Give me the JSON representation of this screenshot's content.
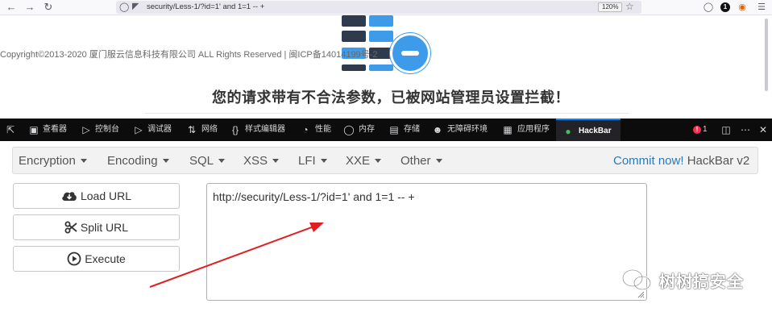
{
  "browser": {
    "url": "security/Less-1/?id=1' and 1=1 -- +",
    "zoom": "120%",
    "profile_badge": "1"
  },
  "page": {
    "copyright": "Copyright©2013-2020 厦门服云信息科技有限公司 ALL Rights Reserved | 闽ICP备14014199号-2",
    "block_message": "您的请求带有不合法参数，已被网站管理员设置拦截！"
  },
  "devtools": {
    "tabs": [
      "查看器",
      "控制台",
      "调试器",
      "网络",
      "样式编辑器",
      "性能",
      "内存",
      "存储",
      "无障碍环境",
      "应用程序",
      "HackBar"
    ],
    "error_count": "1"
  },
  "hackbar": {
    "menu": [
      "Encryption",
      "Encoding",
      "SQL",
      "XSS",
      "LFI",
      "XXE",
      "Other"
    ],
    "commit_link": "Commit now!",
    "version": "HackBar v2",
    "load_url_label": "Load URL",
    "split_url_label": "Split URL",
    "execute_label": "Execute",
    "url_value": "http://security/Less-1/?id=1' and 1=1 -- +"
  },
  "watermark": {
    "text": "树树搞安全"
  },
  "colors": {
    "accent": "#0a84ff",
    "arrow": "#e02020",
    "link": "#2a7ab8",
    "shield_blue": "#3d9be9",
    "shield_dark": "#2f3b4d"
  }
}
